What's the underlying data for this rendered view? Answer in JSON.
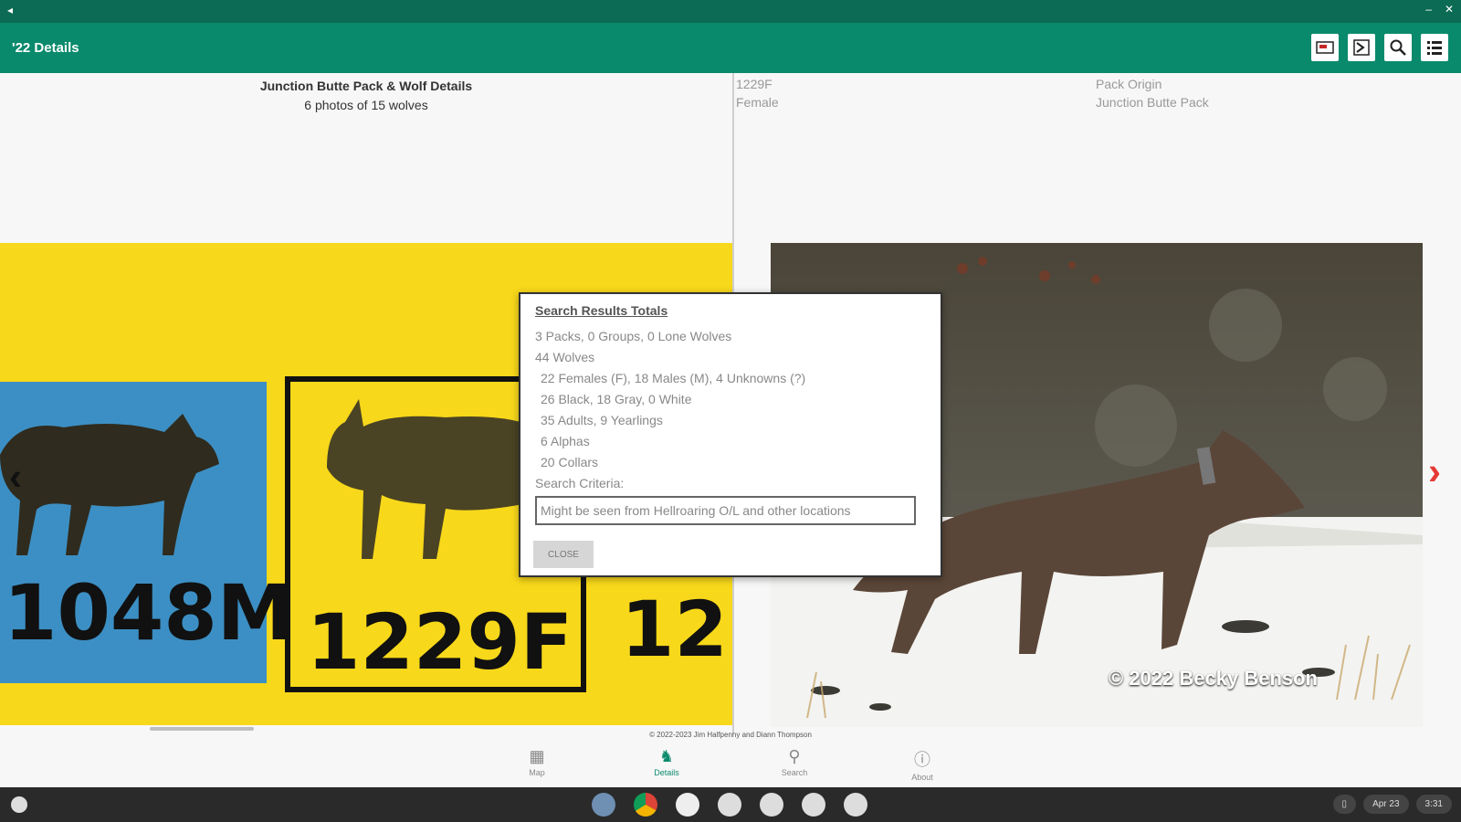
{
  "statusbar": {
    "left_icon": "back-arrow-icon",
    "right_icons": [
      "minimize-icon",
      "close-icon"
    ]
  },
  "appbar": {
    "title": "'22 Details",
    "actions": [
      "map-book-icon",
      "chart-icon",
      "search-icon",
      "list-icon"
    ]
  },
  "left": {
    "title": "Junction Butte Pack & Wolf Details",
    "subtitle": "6 photos of 15 wolves",
    "cards": [
      {
        "label": "1048M",
        "bg": "#3c8fc4"
      },
      {
        "label": "1229F",
        "bg": "#f8d81a",
        "selected": true
      },
      {
        "label": "12"
      }
    ]
  },
  "right": {
    "wolf_id": "1229F",
    "sex": "Female",
    "origin_label": "Pack Origin",
    "origin_value": "Junction Butte Pack",
    "photo_credit": "© 2022 Becky Benson"
  },
  "footer": {
    "copyright": "© 2022-2023 Jim Halfpenny and Diann Thompson"
  },
  "bottom_nav": [
    {
      "label": "Map",
      "icon": "map-icon"
    },
    {
      "label": "Details",
      "icon": "wolf-icon",
      "active": true
    },
    {
      "label": "Search",
      "icon": "search-icon"
    },
    {
      "label": "About",
      "icon": "info-icon"
    }
  ],
  "dialog": {
    "title": "Search Results Totals",
    "lines": [
      "3 Packs, 0 Groups, 0 Lone Wolves",
      "44 Wolves",
      "22 Females (F), 18 Males (M), 4 Unknowns (?)",
      "26 Black, 18 Gray, 0 White",
      "35 Adults, 9 Yearlings",
      "6 Alphas",
      "20 Collars"
    ],
    "criteria_label": "Search Criteria:",
    "criteria_value": "Might be seen from Hellroaring O/L and other locations",
    "close_label": "CLOSE"
  },
  "shelf": {
    "date": "Apr 23",
    "time": "3:31"
  },
  "colors": {
    "primary": "#0a8a6c",
    "primary_dark": "#0b6b55",
    "accent_arrow": "#e53935",
    "card_yellow": "#f8d81a",
    "card_blue": "#3c8fc4"
  }
}
